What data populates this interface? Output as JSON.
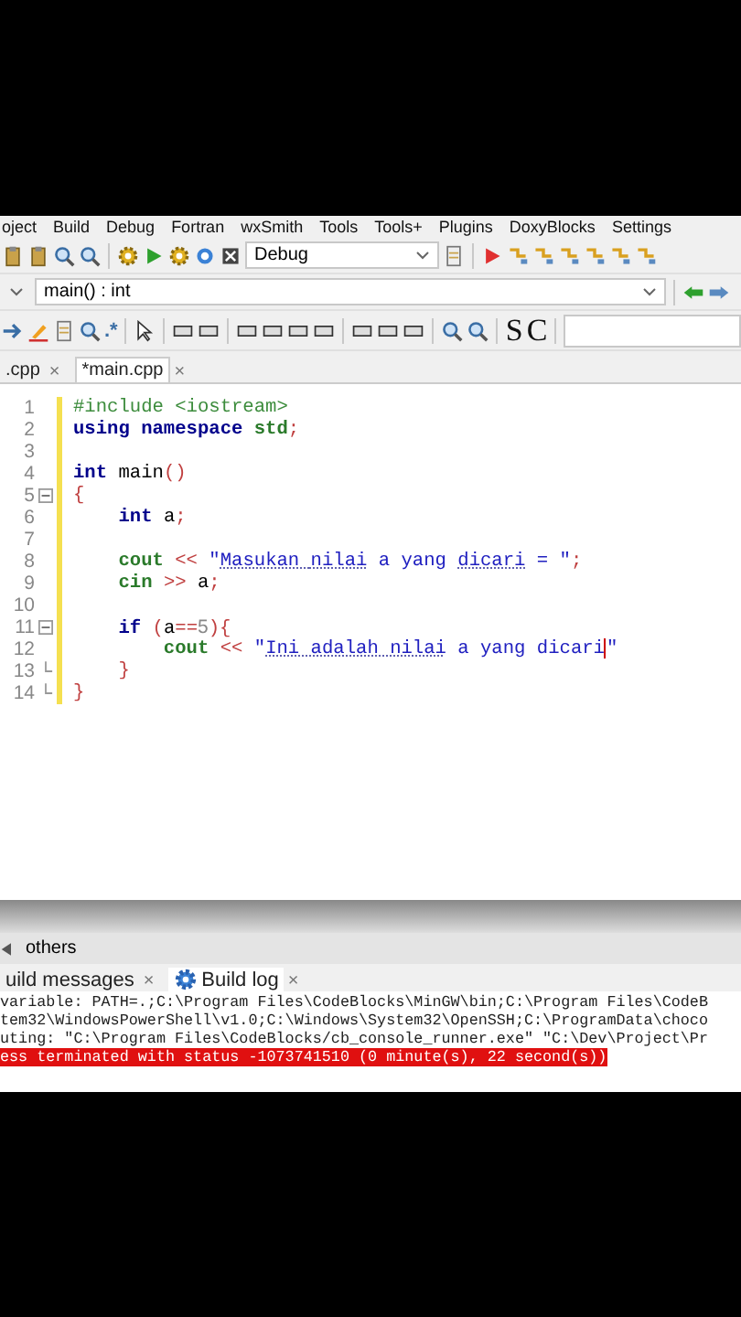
{
  "menu_bar": [
    "oject",
    "Build",
    "Debug",
    "Fortran",
    "wxSmith",
    "Tools",
    "Tools+",
    "Plugins",
    "DoxyBlocks",
    "Settings"
  ],
  "toolbar": {
    "build_target": {
      "value": "Debug"
    },
    "symbol_field": {
      "value": "main() : int"
    },
    "regex_label": ".*",
    "letters": [
      "S",
      "C"
    ]
  },
  "editor_tabs": [
    {
      "label": ".cpp",
      "close": "×",
      "selected": false
    },
    {
      "label": "*main.cpp",
      "close": "×",
      "selected": true
    }
  ],
  "editor": {
    "lines": [
      {
        "number": "1",
        "tokens": [
          {
            "kind": "preprocessor",
            "text": "#include <iostream>"
          }
        ]
      },
      {
        "number": "2",
        "tokens": [
          {
            "kind": "keyword",
            "text": "using namespace "
          },
          {
            "kind": "library",
            "text": "std"
          },
          {
            "kind": "operator",
            "text": ";"
          }
        ]
      },
      {
        "number": "3"
      },
      {
        "number": "4",
        "tokens": [
          {
            "kind": "keyword",
            "text": "int "
          },
          {
            "kind": "plain",
            "text": "main"
          },
          {
            "kind": "operator",
            "text": "()"
          }
        ]
      },
      {
        "number": "5",
        "fold_start": true,
        "tokens": [
          {
            "kind": "operator",
            "text": "{"
          }
        ]
      },
      {
        "number": "6",
        "tokens": [
          {
            "kind": "keyword",
            "text": "    int "
          },
          {
            "kind": "plain",
            "text": "a"
          },
          {
            "kind": "operator",
            "text": ";"
          }
        ]
      },
      {
        "number": "7"
      },
      {
        "number": "8",
        "tokens": [
          {
            "kind": "library",
            "text": "    cout "
          },
          {
            "kind": "operator",
            "text": "<< "
          },
          {
            "kind": "string",
            "text": "\""
          },
          {
            "kind": "misspelled",
            "text": "Masukan "
          },
          {
            "kind": "misspelled",
            "text": "nilai"
          },
          {
            "kind": "string",
            "text": " a yang "
          },
          {
            "kind": "misspelled",
            "text": "dicari"
          },
          {
            "kind": "string",
            "text": " = \""
          },
          {
            "kind": "operator",
            "text": ";"
          }
        ]
      },
      {
        "number": "9",
        "tokens": [
          {
            "kind": "library",
            "text": "    cin "
          },
          {
            "kind": "operator",
            "text": ">> "
          },
          {
            "kind": "plain",
            "text": "a"
          },
          {
            "kind": "operator",
            "text": ";"
          }
        ]
      },
      {
        "number": "10"
      },
      {
        "number": "11",
        "fold_start": true,
        "tokens": [
          {
            "kind": "keyword",
            "text": "    if "
          },
          {
            "kind": "operator",
            "text": "("
          },
          {
            "kind": "plain",
            "text": "a"
          },
          {
            "kind": "operator",
            "text": "=="
          },
          {
            "kind": "number",
            "text": "5"
          },
          {
            "kind": "operator",
            "text": "){"
          }
        ]
      },
      {
        "number": "12",
        "tokens": [
          {
            "kind": "library",
            "text": "        cout "
          },
          {
            "kind": "operator",
            "text": "<< "
          },
          {
            "kind": "string",
            "text": "\""
          },
          {
            "kind": "misspelled",
            "text": "Ini "
          },
          {
            "kind": "misspelled",
            "text": "adalah "
          },
          {
            "kind": "misspelled",
            "text": "nilai"
          },
          {
            "kind": "string",
            "text": " a yang dicari",
            "caret": true
          },
          {
            "kind": "string",
            "text": "\""
          }
        ]
      },
      {
        "number": "13",
        "fold_end": true,
        "tokens": [
          {
            "kind": "operator",
            "text": "    }"
          }
        ]
      },
      {
        "number": "14",
        "fold_end": true,
        "tokens": [
          {
            "kind": "operator",
            "text": "}"
          }
        ]
      }
    ]
  },
  "logs_panel": {
    "title": "others"
  },
  "log_tabs": [
    {
      "kind": "messages",
      "label": "uild messages",
      "close": "×",
      "selected": false
    },
    {
      "kind": "log",
      "label": "Build log",
      "close": "×",
      "selected": true
    }
  ],
  "log_lines": [
    {
      "kind": "normal",
      "text": "variable: PATH=.;C:\\Program Files\\CodeBlocks\\MinGW\\bin;C:\\Program Files\\CodeB"
    },
    {
      "kind": "normal",
      "text": "tem32\\WindowsPowerShell\\v1.0;C:\\Windows\\System32\\OpenSSH;C:\\ProgramData\\choco"
    },
    {
      "kind": "normal",
      "text": "uting: \"C:\\Program Files\\CodeBlocks/cb_console_runner.exe\" \"C:\\Dev\\Project\\Pr"
    },
    {
      "kind": "error",
      "text": "ess terminated with status -1073741510 (0 minute(s), 22 second(s))"
    }
  ]
}
